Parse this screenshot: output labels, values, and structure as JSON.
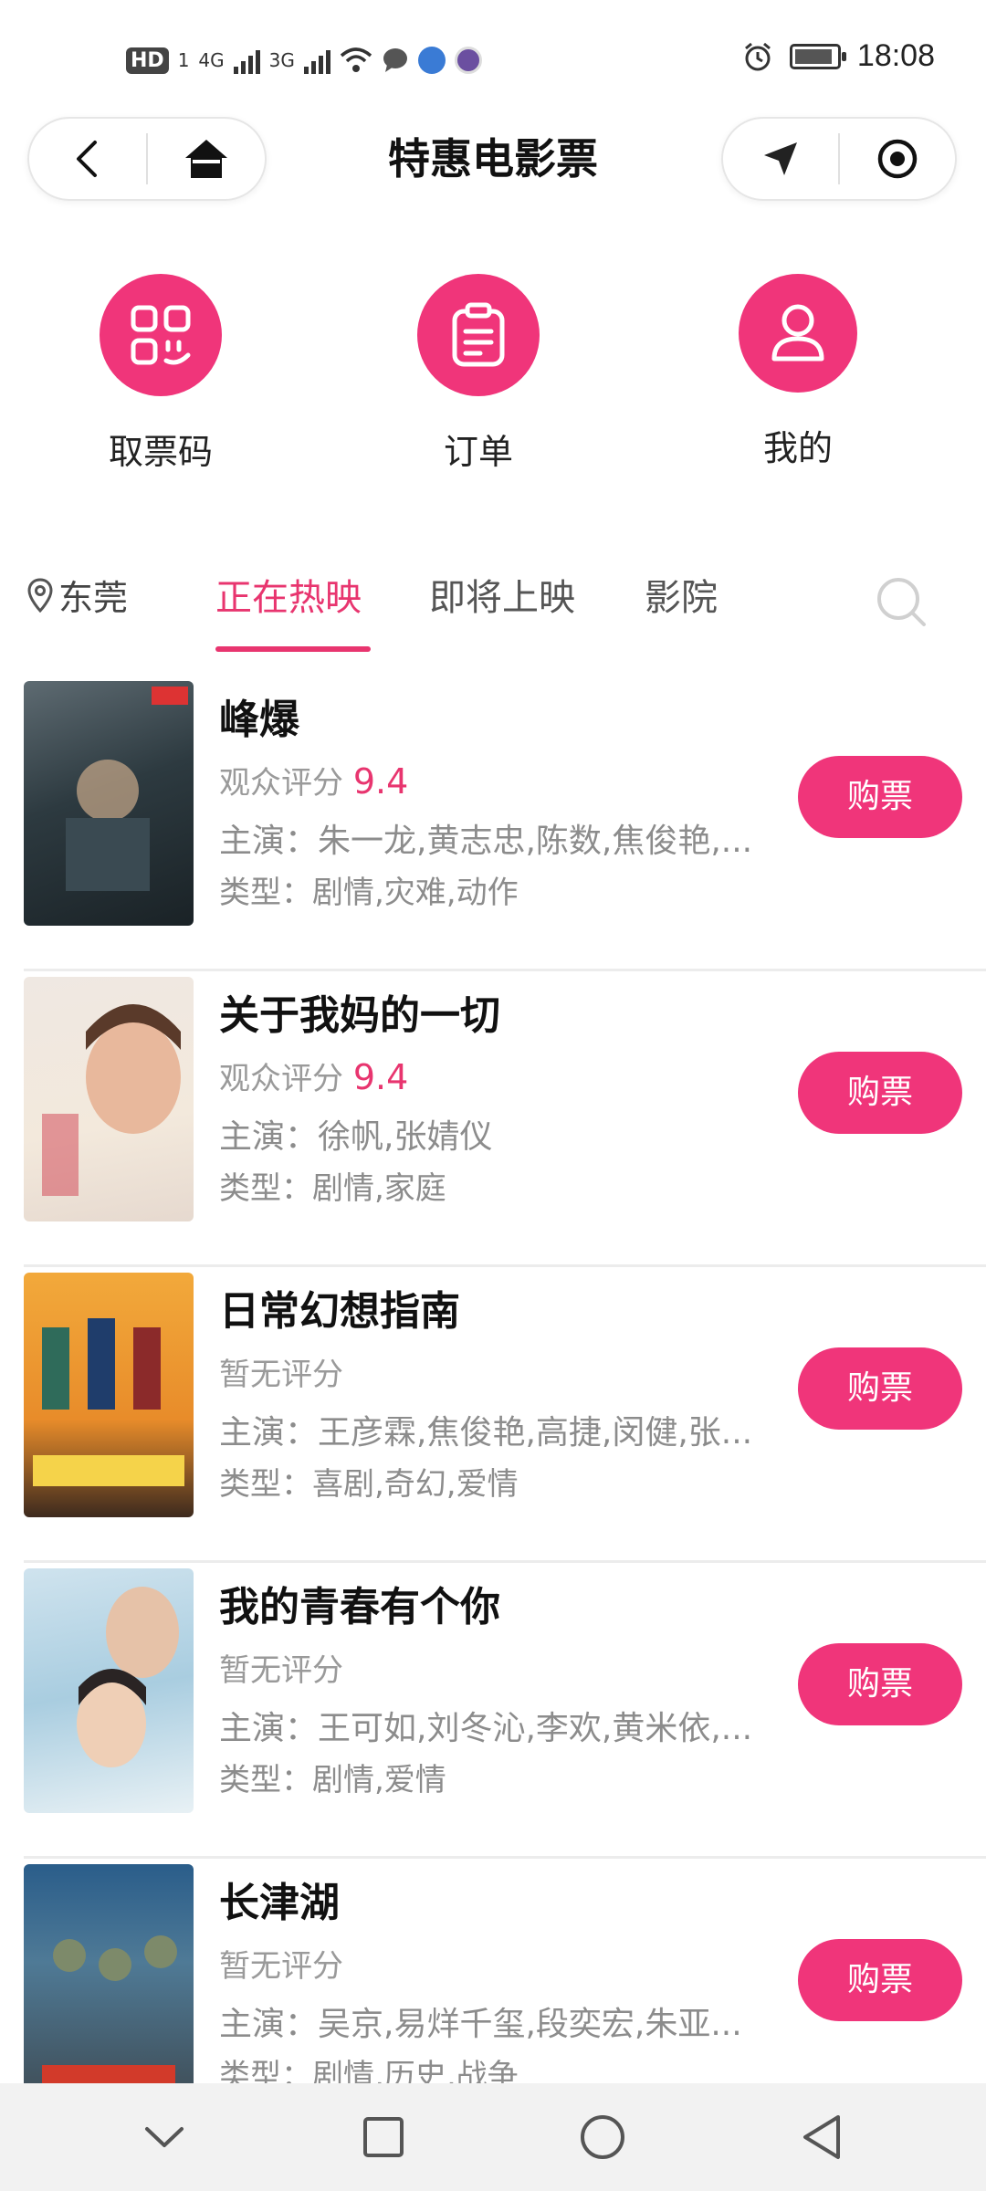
{
  "status_bar": {
    "hd": "HD",
    "sim1": "1",
    "net1": "4G",
    "net2": "3G",
    "time": "18:08"
  },
  "header": {
    "title": "特惠电影票",
    "left_icons": [
      "back-arrow-icon",
      "home-icon"
    ],
    "right_icons": [
      "location-arrow-icon",
      "target-circle-icon"
    ]
  },
  "quick_actions": [
    {
      "label": "取票码",
      "icon": "ticket-code-icon"
    },
    {
      "label": "订单",
      "icon": "order-clipboard-icon"
    },
    {
      "label": "我的",
      "icon": "user-icon"
    }
  ],
  "tabs": {
    "city": "东莞",
    "items": [
      {
        "label": "正在热映",
        "active": true
      },
      {
        "label": "即将上映",
        "active": false
      },
      {
        "label": "影院",
        "active": false
      }
    ]
  },
  "movies": [
    {
      "title": "峰爆",
      "rating_label": "观众评分",
      "score": "9.4",
      "cast": "主演：朱一龙,黄志忠,陈数,焦俊艳,...",
      "genre": "类型：剧情,灾难,动作",
      "buy_label": "购票"
    },
    {
      "title": "关于我妈的一切",
      "rating_label": "观众评分",
      "score": "9.4",
      "cast": "主演：徐帆,张婧仪",
      "genre": "类型：剧情,家庭",
      "buy_label": "购票"
    },
    {
      "title": "日常幻想指南",
      "rating_label": "暂无评分",
      "score": "",
      "cast": "主演：王彦霖,焦俊艳,高捷,闵健,张...",
      "genre": "类型：喜剧,奇幻,爱情",
      "buy_label": "购票"
    },
    {
      "title": "我的青春有个你",
      "rating_label": "暂无评分",
      "score": "",
      "cast": "主演：王可如,刘冬沁,李欢,黄米依,...",
      "genre": "类型：剧情,爱情",
      "buy_label": "购票"
    },
    {
      "title": "长津湖",
      "rating_label": "暂无评分",
      "score": "",
      "cast": "主演：吴京,易烊千玺,段奕宏,朱亚...",
      "genre": "类型：剧情,历史,战争",
      "buy_label": "购票"
    }
  ],
  "colors": {
    "accent": "#f0357a",
    "score": "#e8356f",
    "secondary_text": "#8c8c8c"
  }
}
